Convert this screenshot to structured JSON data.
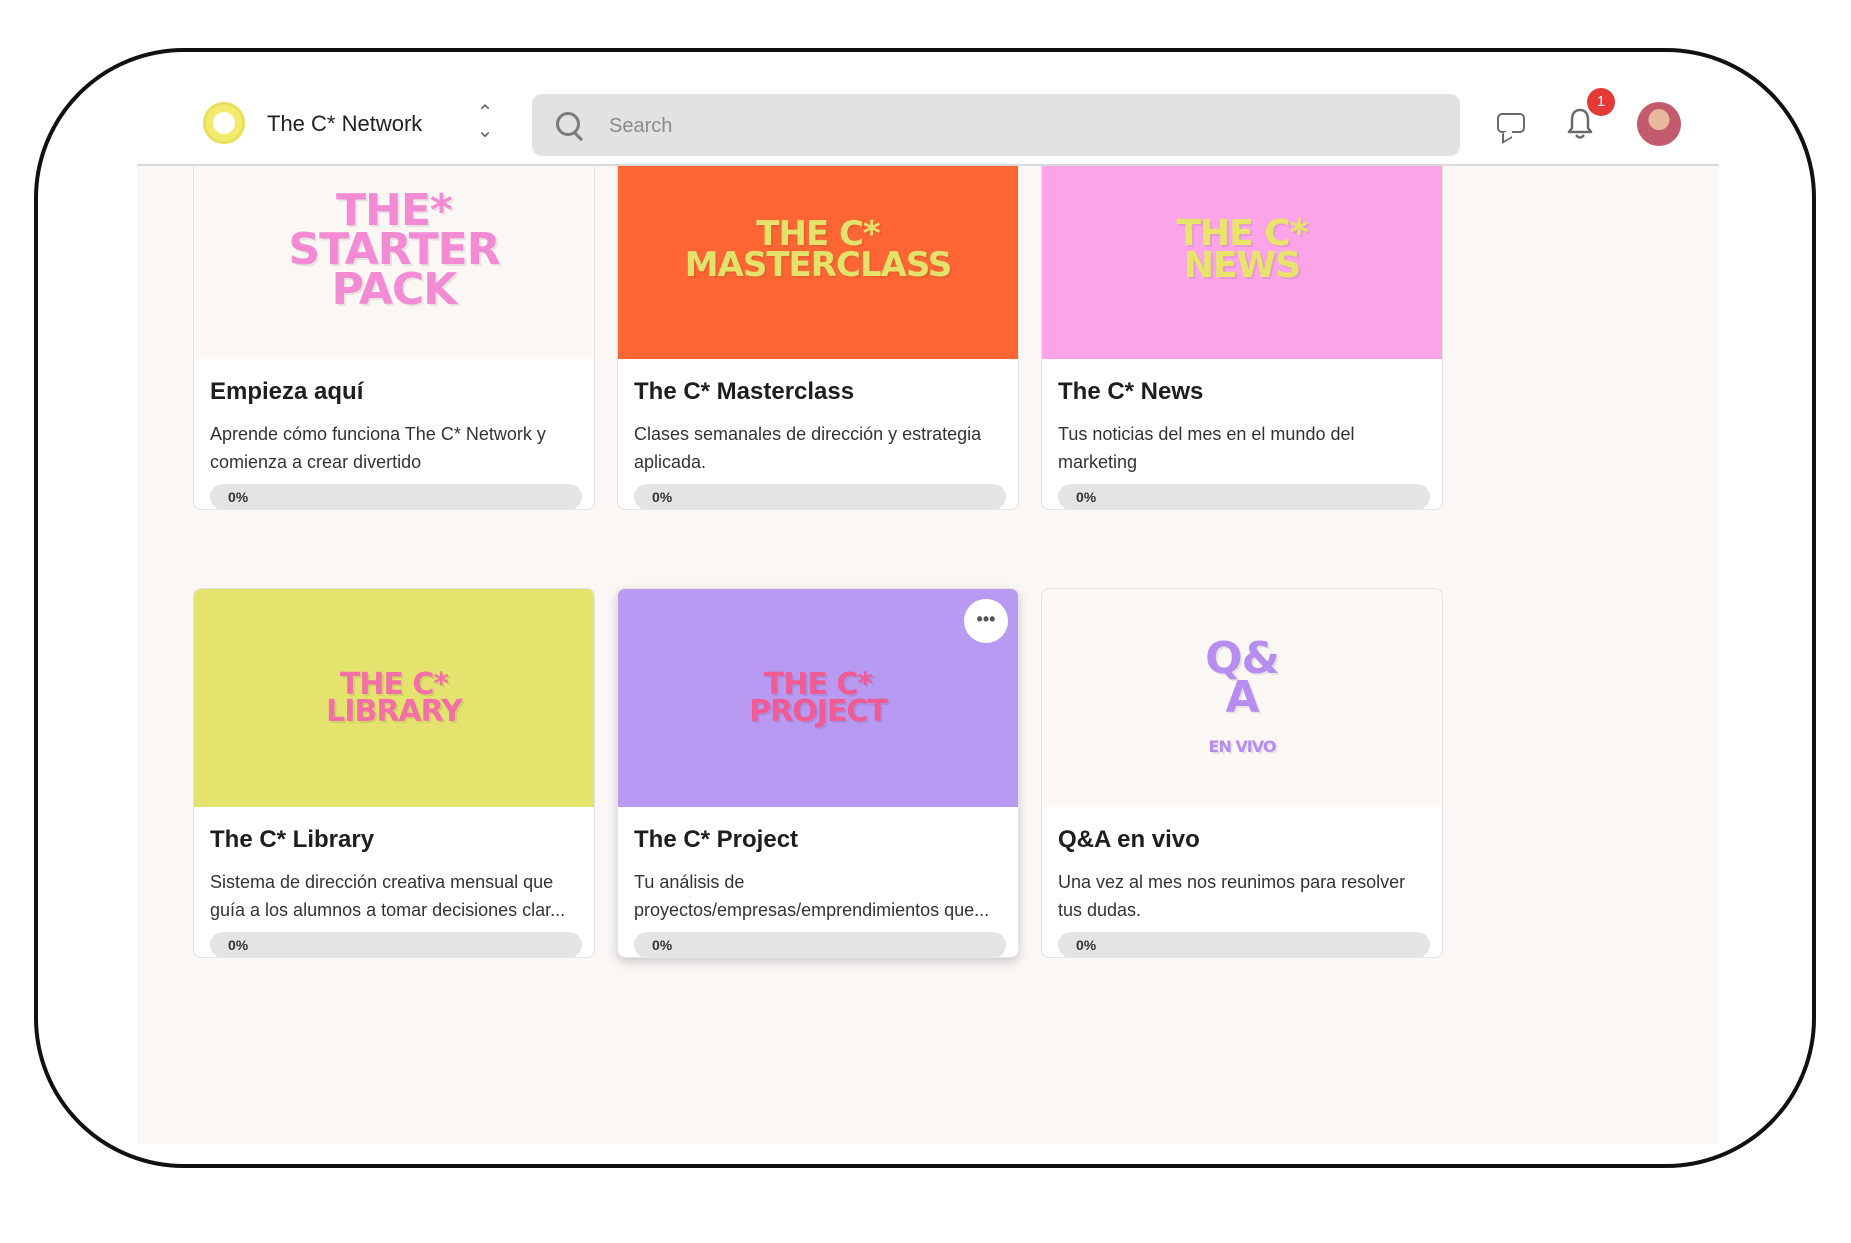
{
  "header": {
    "brand": "The C* Network",
    "switch_icon": "chevron-up-down-icon",
    "search_placeholder": "Search",
    "notification_count": "1"
  },
  "courses": [
    {
      "title": "Empieza aquí",
      "description": "Aprende cómo funciona The C* Network y comienza a crear divertido",
      "progress_label": "0%",
      "progress": 0,
      "cover_bg": "#fbf7f5",
      "cover_text": "THE* STARTER PACK",
      "cover_color": "#f28bd3"
    },
    {
      "title": "The C* Masterclass",
      "description": "Clases semanales de dirección y estrategia aplicada.",
      "progress_label": "0%",
      "progress": 0,
      "cover_bg": "#ff6633",
      "cover_text": "THE C* MASTERCLASS",
      "cover_color": "#e3e36c"
    },
    {
      "title": "The C* News",
      "description": "Tus noticias del mes en el mundo del marketing",
      "progress_label": "0%",
      "progress": 0,
      "cover_bg": "#fba5e8",
      "cover_text": "THE C* NEWS",
      "cover_color": "#e8e46a"
    },
    {
      "title": "The C* Library",
      "description": "Sistema de dirección creativa mensual que guía a los alumnos a tomar decisiones clar...",
      "progress_label": "0%",
      "progress": 0,
      "cover_bg": "#e3e36e",
      "cover_text": "THE C* LIBRARY",
      "cover_color": "#f46fa8"
    },
    {
      "title": "The C* Project",
      "description": "Tu análisis de proyectos/empresas/emprendimientos que...",
      "progress_label": "0%",
      "progress": 0,
      "cover_bg": "#b89af2",
      "cover_text": "THE C* PROJECT",
      "cover_color": "#f15a92",
      "more_label": "•••"
    },
    {
      "title": "Q&A en vivo",
      "description": "Una vez al mes nos reunimos para resolver tus dudas.",
      "progress_label": "0%",
      "progress": 0,
      "cover_bg": "#fbf7f5",
      "cover_text": "Q& A EN VIVO",
      "cover_color": "#b68df0"
    }
  ]
}
